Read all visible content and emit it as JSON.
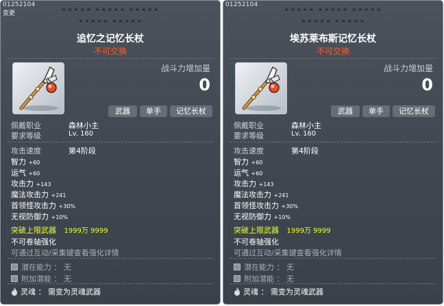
{
  "tooltips": [
    {
      "id_code": "01252104",
      "mod_tag": "变更",
      "stars_row1": "★★★★★ ★★★★★ ★★★★★",
      "stars_row2": "★★★★★ ★★★★★",
      "title": "追忆之记忆长杖",
      "trade_status": "不可交换",
      "icon": "staff-weapon-icon",
      "power_label": "战斗力增加量",
      "power_value": "0",
      "tags": [
        "武器",
        "单手",
        "记忆长杖"
      ],
      "job_label": "佩戴职业",
      "job_value": "森林小主",
      "level_label": "要求等级",
      "level_value": "Lv. 160",
      "speed_label": "攻击速度",
      "speed_value": "第4阶段",
      "stats": [
        {
          "label": "智力",
          "value": "+60"
        },
        {
          "label": "运气",
          "value": "+60"
        },
        {
          "label": "攻击力",
          "value": "+143"
        },
        {
          "label": "魔法攻击力",
          "value": "+241"
        },
        {
          "label": "首领怪攻击力",
          "value": "+30%"
        },
        {
          "label": "无视防御力",
          "value": "+10%"
        }
      ],
      "breakthrough_label": "突破上限武器",
      "breakthrough_value": "1999万 9999",
      "no_scroll": "不可卷轴强化",
      "enhance_hint": "可通过互动/采集键查看强化详情",
      "potential_label": "潜在能力 ： 无",
      "bonus_potential_label": "附加潜能 ： 无",
      "soul_label": "灵魂 ： 需变为灵魂武器"
    },
    {
      "id_code": "01252104",
      "mod_tag": "",
      "stars_row1": "★★★★★ ★★★★★ ★★★★★",
      "stars_row2": "★★★★★ ★★★★★",
      "title": "埃苏莱布斯记忆长杖",
      "trade_status": "不可交换",
      "icon": "staff-weapon-icon",
      "power_label": "战斗力增加量",
      "power_value": "0",
      "tags": [
        "武器",
        "单手",
        "记忆长杖"
      ],
      "job_label": "佩戴职业",
      "job_value": "森林小主",
      "level_label": "要求等级",
      "level_value": "Lv. 160",
      "speed_label": "攻击速度",
      "speed_value": "第4阶段",
      "stats": [
        {
          "label": "智力",
          "value": "+60"
        },
        {
          "label": "运气",
          "value": "+60"
        },
        {
          "label": "攻击力",
          "value": "+143"
        },
        {
          "label": "魔法攻击力",
          "value": "+241"
        },
        {
          "label": "首领怪攻击力",
          "value": "+30%"
        },
        {
          "label": "无视防御力",
          "value": "+10%"
        }
      ],
      "breakthrough_label": "突破上限武器",
      "breakthrough_value": "1999万 9999",
      "no_scroll": "不可卷轴强化",
      "enhance_hint": "可通过互动/采集键查看强化详情",
      "potential_label": "潜在能力 ： 无",
      "bonus_potential_label": "附加潜能 ： 无",
      "soul_label": "灵魂 ： 需变为灵魂武器"
    }
  ],
  "colors": {
    "panel_bg": "#454b54",
    "title": "#ffffff",
    "trade_status": "#ff5a24",
    "breakthrough": "#e9ff3a",
    "hint": "#a9b0b8"
  }
}
